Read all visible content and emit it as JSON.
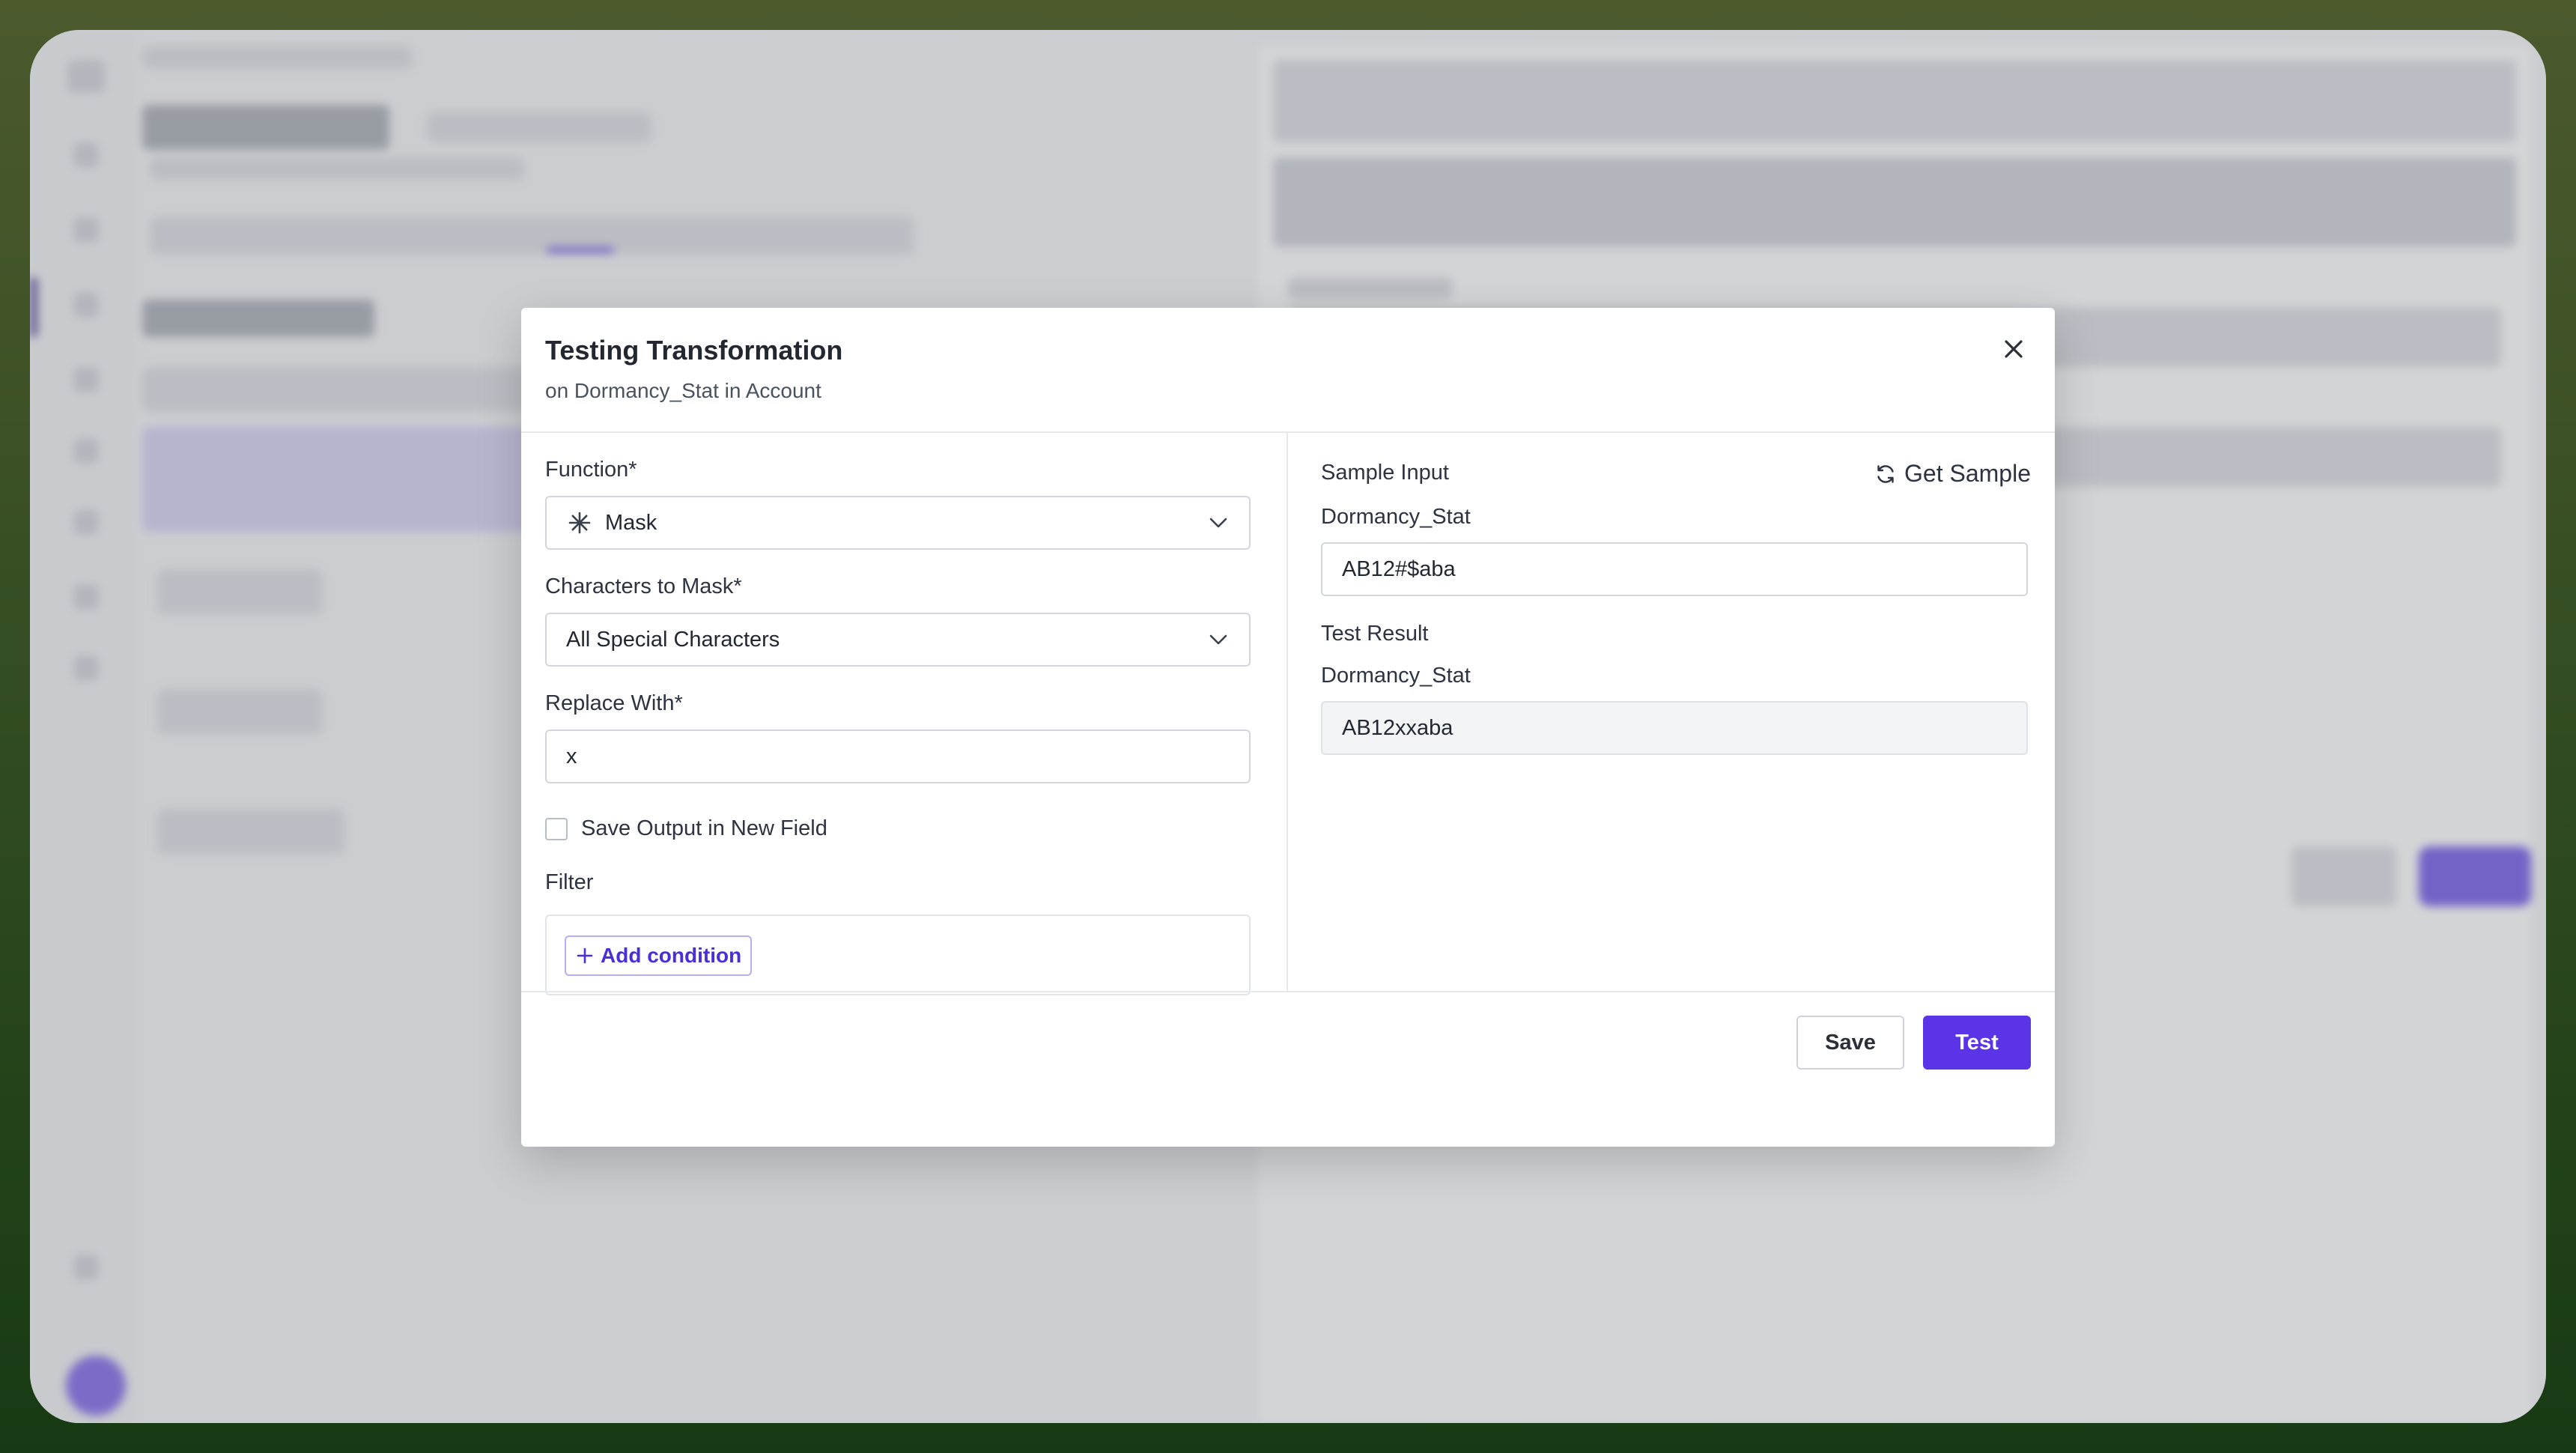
{
  "modal": {
    "title": "Testing Transformation",
    "subtitle": "on Dormancy_Stat in Account",
    "left": {
      "function_label": "Function*",
      "function_value": "Mask",
      "mask_label": "Characters to Mask*",
      "mask_value": "All Special Characters",
      "replace_label": "Replace With*",
      "replace_value": "x",
      "save_output_label": "Save Output in New Field",
      "filter_label": "Filter",
      "add_condition_label": "Add condition"
    },
    "right": {
      "sample_input_label": "Sample Input",
      "get_sample_label": "Get Sample",
      "sample_field_label": "Dormancy_Stat",
      "sample_value": "AB12#$aba",
      "test_result_label": "Test Result",
      "result_field_label": "Dormancy_Stat",
      "result_value": "AB12xxaba"
    },
    "footer": {
      "save_label": "Save",
      "test_label": "Test"
    }
  },
  "colors": {
    "accent": "#5a34e6",
    "frame_gradient_top": "#4c5a2e",
    "frame_gradient_bottom": "#173a14"
  },
  "icons": [
    "close-icon",
    "asterisk-icon",
    "chevron-down-icon",
    "refresh-icon",
    "plus-icon"
  ]
}
